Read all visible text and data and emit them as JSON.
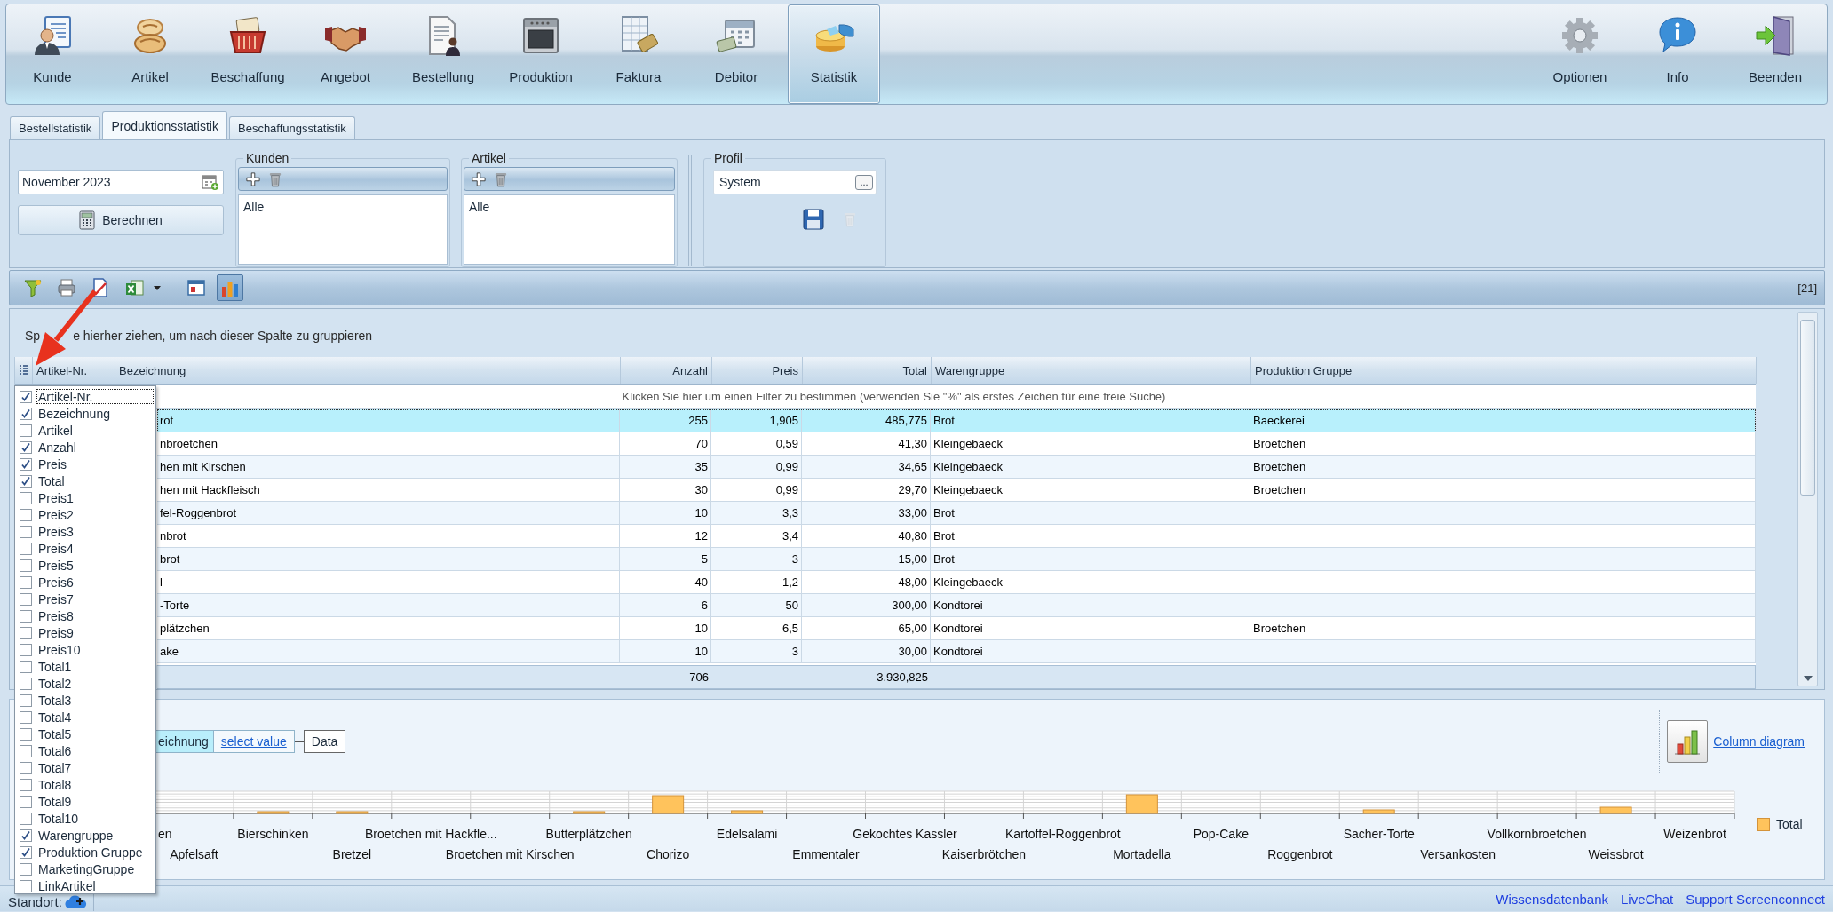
{
  "toolbar": {
    "items": [
      {
        "label": "Kunde",
        "kind": "customers",
        "selected": false
      },
      {
        "label": "Artikel",
        "kind": "articles",
        "selected": false
      },
      {
        "label": "Beschaffung",
        "kind": "procurement",
        "selected": false
      },
      {
        "label": "Angebot",
        "kind": "offers",
        "selected": false
      },
      {
        "label": "Bestellung",
        "kind": "orders",
        "selected": false
      },
      {
        "label": "Produktion",
        "kind": "production",
        "selected": false
      },
      {
        "label": "Faktura",
        "kind": "invoicing",
        "selected": false
      },
      {
        "label": "Debitor",
        "kind": "debtors",
        "selected": false
      },
      {
        "label": "Statistik",
        "kind": "statistics",
        "selected": true
      }
    ],
    "right_items": [
      {
        "label": "Optionen",
        "kind": "options"
      },
      {
        "label": "Info",
        "kind": "info"
      },
      {
        "label": "Beenden",
        "kind": "exit"
      }
    ]
  },
  "tabs": [
    {
      "label": "Bestellstatistik",
      "selected": false
    },
    {
      "label": "Produktionsstatistik",
      "selected": true
    },
    {
      "label": "Beschaffungsstatistik",
      "selected": false
    }
  ],
  "filter_panel": {
    "period_field": {
      "value": "November 2023"
    },
    "calculate_button": "Berechnen",
    "groups": [
      {
        "title": "Kunden",
        "items": [
          "Alle"
        ]
      },
      {
        "title": "Artikel",
        "items": [
          "Alle"
        ]
      }
    ],
    "profile": {
      "title": "Profil",
      "value": "System",
      "browse_button": "...",
      "save_disabled": false,
      "delete_disabled": true
    }
  },
  "grid_toolbar": {
    "buttons": [
      {
        "kind": "filter",
        "pressed": false,
        "dropdown": false
      },
      {
        "kind": "print",
        "pressed": false,
        "dropdown": false
      },
      {
        "kind": "pdf",
        "pressed": false,
        "dropdown": false
      },
      {
        "kind": "excel",
        "pressed": false,
        "dropdown": true
      },
      {
        "kind": "layout",
        "pressed": false,
        "dropdown": false
      },
      {
        "kind": "chart",
        "pressed": true,
        "dropdown": false
      }
    ],
    "count": "[21]"
  },
  "grid": {
    "group_hint": [
      "Sp",
      "e hierher ziehen, um nach dieser Spalte zu gruppieren"
    ],
    "columns": [
      {
        "label": "Artikel-Nr.",
        "kind": "text"
      },
      {
        "label": "Bezeichnung",
        "kind": "text"
      },
      {
        "label": "Anzahl",
        "kind": "number"
      },
      {
        "label": "Preis",
        "kind": "number"
      },
      {
        "label": "Total",
        "kind": "number"
      },
      {
        "label": "Warengruppe",
        "kind": "text"
      },
      {
        "label": "Produktion Gruppe",
        "kind": "text"
      }
    ],
    "filter_hint": "Klicken Sie hier um einen Filter zu bestimmen (verwenden Sie \"%\" als erstes Zeichen für eine freie Suche)",
    "rows": [
      {
        "selected": true,
        "bezeichnung": "rot",
        "anzahl": "255",
        "preis": "1,905",
        "total": "485,775",
        "warengruppe": "Brot",
        "produktion_gruppe": "Baeckerei"
      },
      {
        "selected": false,
        "bezeichnung": "nbroetchen",
        "anzahl": "70",
        "preis": "0,59",
        "total": "41,30",
        "warengruppe": "Kleingebaeck",
        "produktion_gruppe": "Broetchen"
      },
      {
        "selected": false,
        "bezeichnung": "hen mit Kirschen",
        "anzahl": "35",
        "preis": "0,99",
        "total": "34,65",
        "warengruppe": "Kleingebaeck",
        "produktion_gruppe": "Broetchen"
      },
      {
        "selected": false,
        "bezeichnung": "hen mit Hackfleisch",
        "anzahl": "30",
        "preis": "0,99",
        "total": "29,70",
        "warengruppe": "Kleingebaeck",
        "produktion_gruppe": "Broetchen"
      },
      {
        "selected": false,
        "bezeichnung": "fel-Roggenbrot",
        "anzahl": "10",
        "preis": "3,3",
        "total": "33,00",
        "warengruppe": "Brot"
      },
      {
        "selected": false,
        "bezeichnung": "nbrot",
        "anzahl": "12",
        "preis": "3,4",
        "total": "40,80",
        "warengruppe": "Brot"
      },
      {
        "selected": false,
        "bezeichnung": "brot",
        "anzahl": "5",
        "preis": "3",
        "total": "15,00",
        "warengruppe": "Brot"
      },
      {
        "selected": false,
        "bezeichnung": "l",
        "anzahl": "40",
        "preis": "1,2",
        "total": "48,00",
        "warengruppe": "Kleingebaeck"
      },
      {
        "selected": false,
        "bezeichnung": "-Torte",
        "anzahl": "6",
        "preis": "50",
        "total": "300,00",
        "warengruppe": "Kondtorei"
      },
      {
        "selected": false,
        "bezeichnung": "plätzchen",
        "anzahl": "10",
        "preis": "6,5",
        "total": "65,00",
        "warengruppe": "Kondtorei",
        "produktion_gruppe": "Broetchen"
      },
      {
        "selected": false,
        "bezeichnung": "ake",
        "anzahl": "10",
        "preis": "3",
        "total": "30,00",
        "warengruppe": "Kondtorei"
      }
    ],
    "totals": {
      "anzahl": "706",
      "total": "3.930,825"
    }
  },
  "column_chooser": {
    "items": [
      {
        "label": "Artikel-Nr.",
        "checked": true,
        "selected": true
      },
      {
        "label": "Bezeichnung",
        "checked": true,
        "selected": false
      },
      {
        "label": "Artikel",
        "checked": false,
        "selected": false
      },
      {
        "label": "Anzahl",
        "checked": true,
        "selected": false
      },
      {
        "label": "Preis",
        "checked": true,
        "selected": false
      },
      {
        "label": "Total",
        "checked": true,
        "selected": false
      },
      {
        "label": "Preis1",
        "checked": false,
        "selected": false
      },
      {
        "label": "Preis2",
        "checked": false,
        "selected": false
      },
      {
        "label": "Preis3",
        "checked": false,
        "selected": false
      },
      {
        "label": "Preis4",
        "checked": false,
        "selected": false
      },
      {
        "label": "Preis5",
        "checked": false,
        "selected": false
      },
      {
        "label": "Preis6",
        "checked": false,
        "selected": false
      },
      {
        "label": "Preis7",
        "checked": false,
        "selected": false
      },
      {
        "label": "Preis8",
        "checked": false,
        "selected": false
      },
      {
        "label": "Preis9",
        "checked": false,
        "selected": false
      },
      {
        "label": "Preis10",
        "checked": false,
        "selected": false
      },
      {
        "label": "Total1",
        "checked": false,
        "selected": false
      },
      {
        "label": "Total2",
        "checked": false,
        "selected": false
      },
      {
        "label": "Total3",
        "checked": false,
        "selected": false
      },
      {
        "label": "Total4",
        "checked": false,
        "selected": false
      },
      {
        "label": "Total5",
        "checked": false,
        "selected": false
      },
      {
        "label": "Total6",
        "checked": false,
        "selected": false
      },
      {
        "label": "Total7",
        "checked": false,
        "selected": false
      },
      {
        "label": "Total8",
        "checked": false,
        "selected": false
      },
      {
        "label": "Total9",
        "checked": false,
        "selected": false
      },
      {
        "label": "Total10",
        "checked": false,
        "selected": false
      },
      {
        "label": "Warengruppe",
        "checked": true,
        "selected": false
      },
      {
        "label": "Produktion Gruppe",
        "checked": true,
        "selected": false
      },
      {
        "label": "MarketingGruppe",
        "checked": false,
        "selected": false
      },
      {
        "label": "LinkArtikel",
        "checked": false,
        "selected": false
      }
    ]
  },
  "chart_panel": {
    "pivot": [
      {
        "label": "eichnung",
        "kind": "field"
      },
      {
        "label": "select value",
        "kind": "link"
      },
      {
        "label": "Data",
        "kind": "data"
      }
    ],
    "view_button": "Column diagram",
    "chart": {
      "x_labels": [
        "en",
        "Apfelsaft",
        "Bierschinken",
        "Bretzel",
        "Broetchen mit Hackfle...",
        "Broetchen mit Kirschen",
        "Butterplätzchen",
        "Chorizo",
        "Edelsalami",
        "Emmentaler",
        "Gekochtes Kassler",
        "Kaiserbrötchen",
        "Kartoffel-Roggenbrot",
        "Mortadella",
        "Pop-Cake",
        "Roggenbrot",
        "Sacher-Torte",
        "Versankosten",
        "Vollkornbroetchen",
        "Weissbrot",
        "Weizenbrot"
      ],
      "legend": "Total"
    }
  },
  "status_bar": {
    "label": "Standort:",
    "links": [
      "Wissensdatenbank",
      "LiveChat",
      "Support Screenconnect"
    ]
  }
}
